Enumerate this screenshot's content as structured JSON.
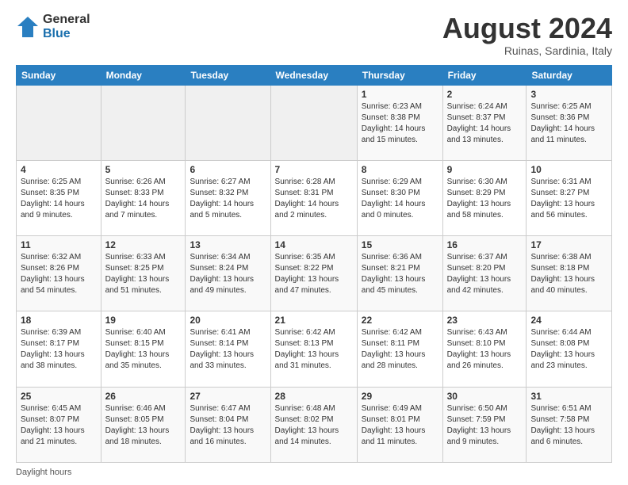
{
  "logo": {
    "general": "General",
    "blue": "Blue"
  },
  "header": {
    "month_year": "August 2024",
    "location": "Ruinas, Sardinia, Italy"
  },
  "days_of_week": [
    "Sunday",
    "Monday",
    "Tuesday",
    "Wednesday",
    "Thursday",
    "Friday",
    "Saturday"
  ],
  "footer": {
    "daylight_hours": "Daylight hours"
  },
  "weeks": [
    [
      {
        "day": "",
        "info": ""
      },
      {
        "day": "",
        "info": ""
      },
      {
        "day": "",
        "info": ""
      },
      {
        "day": "",
        "info": ""
      },
      {
        "day": "1",
        "info": "Sunrise: 6:23 AM\nSunset: 8:38 PM\nDaylight: 14 hours and 15 minutes."
      },
      {
        "day": "2",
        "info": "Sunrise: 6:24 AM\nSunset: 8:37 PM\nDaylight: 14 hours and 13 minutes."
      },
      {
        "day": "3",
        "info": "Sunrise: 6:25 AM\nSunset: 8:36 PM\nDaylight: 14 hours and 11 minutes."
      }
    ],
    [
      {
        "day": "4",
        "info": "Sunrise: 6:25 AM\nSunset: 8:35 PM\nDaylight: 14 hours and 9 minutes."
      },
      {
        "day": "5",
        "info": "Sunrise: 6:26 AM\nSunset: 8:33 PM\nDaylight: 14 hours and 7 minutes."
      },
      {
        "day": "6",
        "info": "Sunrise: 6:27 AM\nSunset: 8:32 PM\nDaylight: 14 hours and 5 minutes."
      },
      {
        "day": "7",
        "info": "Sunrise: 6:28 AM\nSunset: 8:31 PM\nDaylight: 14 hours and 2 minutes."
      },
      {
        "day": "8",
        "info": "Sunrise: 6:29 AM\nSunset: 8:30 PM\nDaylight: 14 hours and 0 minutes."
      },
      {
        "day": "9",
        "info": "Sunrise: 6:30 AM\nSunset: 8:29 PM\nDaylight: 13 hours and 58 minutes."
      },
      {
        "day": "10",
        "info": "Sunrise: 6:31 AM\nSunset: 8:27 PM\nDaylight: 13 hours and 56 minutes."
      }
    ],
    [
      {
        "day": "11",
        "info": "Sunrise: 6:32 AM\nSunset: 8:26 PM\nDaylight: 13 hours and 54 minutes."
      },
      {
        "day": "12",
        "info": "Sunrise: 6:33 AM\nSunset: 8:25 PM\nDaylight: 13 hours and 51 minutes."
      },
      {
        "day": "13",
        "info": "Sunrise: 6:34 AM\nSunset: 8:24 PM\nDaylight: 13 hours and 49 minutes."
      },
      {
        "day": "14",
        "info": "Sunrise: 6:35 AM\nSunset: 8:22 PM\nDaylight: 13 hours and 47 minutes."
      },
      {
        "day": "15",
        "info": "Sunrise: 6:36 AM\nSunset: 8:21 PM\nDaylight: 13 hours and 45 minutes."
      },
      {
        "day": "16",
        "info": "Sunrise: 6:37 AM\nSunset: 8:20 PM\nDaylight: 13 hours and 42 minutes."
      },
      {
        "day": "17",
        "info": "Sunrise: 6:38 AM\nSunset: 8:18 PM\nDaylight: 13 hours and 40 minutes."
      }
    ],
    [
      {
        "day": "18",
        "info": "Sunrise: 6:39 AM\nSunset: 8:17 PM\nDaylight: 13 hours and 38 minutes."
      },
      {
        "day": "19",
        "info": "Sunrise: 6:40 AM\nSunset: 8:15 PM\nDaylight: 13 hours and 35 minutes."
      },
      {
        "day": "20",
        "info": "Sunrise: 6:41 AM\nSunset: 8:14 PM\nDaylight: 13 hours and 33 minutes."
      },
      {
        "day": "21",
        "info": "Sunrise: 6:42 AM\nSunset: 8:13 PM\nDaylight: 13 hours and 31 minutes."
      },
      {
        "day": "22",
        "info": "Sunrise: 6:42 AM\nSunset: 8:11 PM\nDaylight: 13 hours and 28 minutes."
      },
      {
        "day": "23",
        "info": "Sunrise: 6:43 AM\nSunset: 8:10 PM\nDaylight: 13 hours and 26 minutes."
      },
      {
        "day": "24",
        "info": "Sunrise: 6:44 AM\nSunset: 8:08 PM\nDaylight: 13 hours and 23 minutes."
      }
    ],
    [
      {
        "day": "25",
        "info": "Sunrise: 6:45 AM\nSunset: 8:07 PM\nDaylight: 13 hours and 21 minutes."
      },
      {
        "day": "26",
        "info": "Sunrise: 6:46 AM\nSunset: 8:05 PM\nDaylight: 13 hours and 18 minutes."
      },
      {
        "day": "27",
        "info": "Sunrise: 6:47 AM\nSunset: 8:04 PM\nDaylight: 13 hours and 16 minutes."
      },
      {
        "day": "28",
        "info": "Sunrise: 6:48 AM\nSunset: 8:02 PM\nDaylight: 13 hours and 14 minutes."
      },
      {
        "day": "29",
        "info": "Sunrise: 6:49 AM\nSunset: 8:01 PM\nDaylight: 13 hours and 11 minutes."
      },
      {
        "day": "30",
        "info": "Sunrise: 6:50 AM\nSunset: 7:59 PM\nDaylight: 13 hours and 9 minutes."
      },
      {
        "day": "31",
        "info": "Sunrise: 6:51 AM\nSunset: 7:58 PM\nDaylight: 13 hours and 6 minutes."
      }
    ]
  ]
}
